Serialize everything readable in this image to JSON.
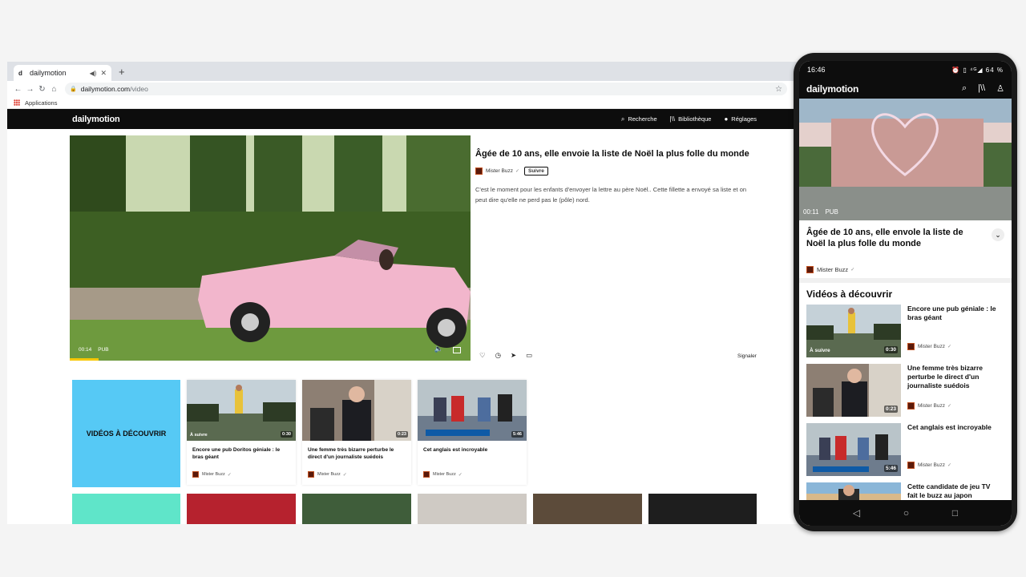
{
  "browser": {
    "tab_title": "dailymotion",
    "favicon": "d",
    "new_tab": "+",
    "url_host": "dailymotion.com",
    "url_path": "/video",
    "bookmark_apps": "Applications"
  },
  "site": {
    "logo": "dailymotion",
    "nav": {
      "search": "Recherche",
      "library": "Bibliothèque",
      "settings": "Réglages"
    }
  },
  "video": {
    "time": "00:14",
    "ad_label": "PUB",
    "title": "Âgée de 10 ans, elle envoie la liste de Noël la plus folle du monde",
    "channel": "Mister Buzz",
    "follow_label": "Suivre",
    "description": "C'est le moment pour les enfants d'envoyer la lettre au père Noël.. Cette fillette a envoyé sa liste et on peut dire qu'elle ne perd pas le (pôle) nord.",
    "report_label": "Signaler"
  },
  "discover": {
    "tile_label": "VIDÉOS À DÉCOUVRIR",
    "cards": [
      {
        "title": "Encore une pub Doritos géniale : le bras géant",
        "badge_left": "À suivre",
        "duration": "0:30",
        "channel": "Mister Buzz"
      },
      {
        "title": "Une femme très bizarre perturbe le direct d'un journaliste suédois",
        "badge_left": "",
        "duration": "0:23",
        "channel": "Mister Buzz"
      },
      {
        "title": "Cet anglais  est  incroyable",
        "badge_left": "",
        "duration": "5:46",
        "channel": "Mister Buzz"
      }
    ]
  },
  "mobile": {
    "status_time": "16:46",
    "status_right": "⏰ ▯ ⁴ᴳ◢ 64 %",
    "logo": "dailymotion",
    "player_time": "00:11",
    "player_ad": "PUB",
    "title": "Âgée de 10 ans, elle envole la liste de Noël la plus folle du monde",
    "channel": "Mister Buzz",
    "section_title": "Vidéos à découvrir",
    "items": [
      {
        "title": "Encore une pub géniale : le bras géant",
        "badge_left": "À suivre",
        "duration": "0:30",
        "channel": "Mister Buzz"
      },
      {
        "title": "Une femme très bizarre perturbe le direct d'un journaliste suédois",
        "badge_left": "",
        "duration": "0:23",
        "channel": "Mister Buzz"
      },
      {
        "title": "Cet anglais  est  incroyable",
        "badge_left": "",
        "duration": "5:46",
        "channel": "Mister Buzz"
      },
      {
        "title": "Cette candidate de jeu TV fait le buzz au japon",
        "badge_left": "",
        "duration": "",
        "channel": ""
      }
    ]
  },
  "colors": {
    "header_bg": "#0d0d0d",
    "discover_tile": "#56c9f5",
    "second_row_tile": "#5fe5c9",
    "progress": "#f7c700"
  }
}
